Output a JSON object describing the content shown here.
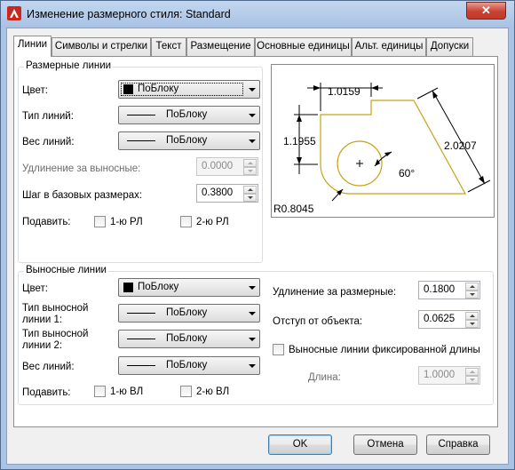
{
  "window": {
    "title": "Изменение размерного стиля: Standard",
    "close_glyph": "✕",
    "app_icon": "autocad-a-icon"
  },
  "tabs": [
    {
      "label": "Линии",
      "active": true
    },
    {
      "label": "Символы и стрелки",
      "active": false
    },
    {
      "label": "Текст",
      "active": false
    },
    {
      "label": "Размещение",
      "active": false
    },
    {
      "label": "Основные единицы",
      "active": false
    },
    {
      "label": "Альт. единицы",
      "active": false
    },
    {
      "label": "Допуски",
      "active": false
    }
  ],
  "dim_lines": {
    "title": "Размерные линии",
    "color_label": "Цвет:",
    "color_value": "ПоБлоку",
    "linetype_label": "Тип линий:",
    "linetype_value": "ПоБлоку",
    "lineweight_label": "Вес линий:",
    "lineweight_value": "ПоБлоку",
    "extend_label": "Удлинение за выносные:",
    "extend_value": "0.0000",
    "baseline_label": "Шаг в базовых размерах:",
    "baseline_value": "0.3800",
    "suppress_label": "Подавить:",
    "suppress_1": "1-ю РЛ",
    "suppress_2": "2-ю РЛ"
  },
  "ext_lines": {
    "title": "Выносные линии",
    "color_label": "Цвет:",
    "color_value": "ПоБлоку",
    "lt1_label_line1": "Тип выносной",
    "lt1_label_line2": "линии 1:",
    "lt1_value": "ПоБлоку",
    "lt2_label_line1": "Тип выносной",
    "lt2_label_line2": "линии 2:",
    "lt2_value": "ПоБлоку",
    "lineweight_label": "Вес линий:",
    "lineweight_value": "ПоБлоку",
    "suppress_label": "Подавить:",
    "suppress_1": "1-ю ВЛ",
    "suppress_2": "2-ю ВЛ",
    "extend_label": "Удлинение за размерные:",
    "extend_value": "0.1800",
    "offset_label": "Отступ от объекта:",
    "offset_value": "0.0625",
    "fixed_label": "Выносные линии фиксированной длины",
    "length_label": "Длина:",
    "length_value": "1.0000"
  },
  "preview": {
    "dim_top": "1.0159",
    "dim_left": "1.1955",
    "dim_diag": "2.0207",
    "dim_angle": "60°",
    "dim_radius": "R0.8045"
  },
  "buttons": {
    "ok": "OK",
    "cancel": "Отмена",
    "help": "Справка"
  },
  "colors": {
    "outline_color": "#c8a216",
    "title_bar": "#a9c2e4",
    "close_button": "#c74232"
  }
}
